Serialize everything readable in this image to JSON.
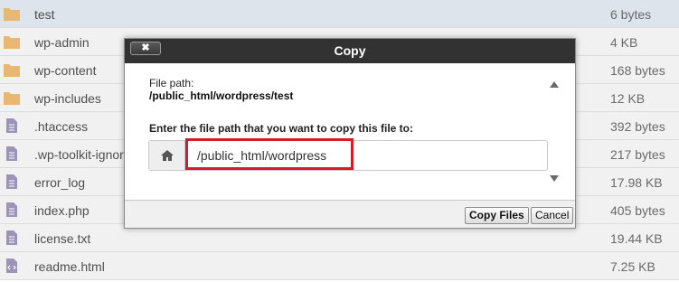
{
  "files": [
    {
      "name": "test",
      "size": "6 bytes",
      "type": "folder",
      "selected": true
    },
    {
      "name": "wp-admin",
      "size": "4 KB",
      "type": "folder"
    },
    {
      "name": "wp-content",
      "size": "168 bytes",
      "type": "folder"
    },
    {
      "name": "wp-includes",
      "size": "12 KB",
      "type": "folder"
    },
    {
      "name": ".htaccess",
      "size": "392 bytes",
      "type": "file"
    },
    {
      "name": ".wp-toolkit-ignor",
      "size": "217 bytes",
      "type": "file"
    },
    {
      "name": "error_log",
      "size": "17.98 KB",
      "type": "file"
    },
    {
      "name": "index.php",
      "size": "405 bytes",
      "type": "file"
    },
    {
      "name": "license.txt",
      "size": "19.44 KB",
      "type": "file"
    },
    {
      "name": "readme.html",
      "size": "7.25 KB",
      "type": "html"
    }
  ],
  "dialog": {
    "title": "Copy",
    "close_label": "✖",
    "file_path_label": "File path:",
    "file_path_value": "/public_html/wordpress/test",
    "enter_label": "Enter the file path that you want to copy this file to:",
    "destination_value": "/public_html/wordpress",
    "copy_button": "Copy Files",
    "cancel_button": "Cancel"
  },
  "colors": {
    "folder": "#e8b872",
    "file": "#9b93b8",
    "header": "#323232",
    "highlight": "#d21c2c"
  },
  "icons": {
    "folder": "folder-icon",
    "file": "file-icon",
    "html": "html-file-icon",
    "home": "home-icon",
    "close": "close-icon"
  }
}
